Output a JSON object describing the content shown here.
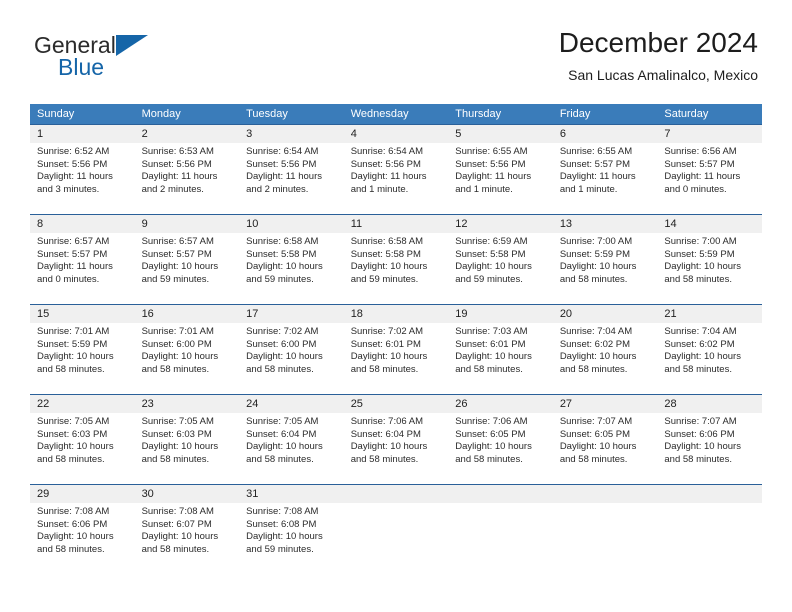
{
  "brand": {
    "name_part1": "General",
    "name_part2": "Blue",
    "flag_icon": "triangle-flag-icon"
  },
  "header": {
    "title": "December 2024",
    "subtitle": "San Lucas Amalinalco, Mexico"
  },
  "colors": {
    "header_blue": "#3a7cba",
    "row_divider_blue": "#2a6099",
    "daynum_background": "#f0f0f0",
    "brand_blue": "#1565a8",
    "text": "#2b2b2b"
  },
  "weekdays": [
    "Sunday",
    "Monday",
    "Tuesday",
    "Wednesday",
    "Thursday",
    "Friday",
    "Saturday"
  ],
  "weeks": [
    {
      "days": [
        {
          "num": "1",
          "sunrise": "Sunrise: 6:52 AM",
          "sunset": "Sunset: 5:56 PM",
          "daylight": "Daylight: 11 hours and 3 minutes."
        },
        {
          "num": "2",
          "sunrise": "Sunrise: 6:53 AM",
          "sunset": "Sunset: 5:56 PM",
          "daylight": "Daylight: 11 hours and 2 minutes."
        },
        {
          "num": "3",
          "sunrise": "Sunrise: 6:54 AM",
          "sunset": "Sunset: 5:56 PM",
          "daylight": "Daylight: 11 hours and 2 minutes."
        },
        {
          "num": "4",
          "sunrise": "Sunrise: 6:54 AM",
          "sunset": "Sunset: 5:56 PM",
          "daylight": "Daylight: 11 hours and 1 minute."
        },
        {
          "num": "5",
          "sunrise": "Sunrise: 6:55 AM",
          "sunset": "Sunset: 5:56 PM",
          "daylight": "Daylight: 11 hours and 1 minute."
        },
        {
          "num": "6",
          "sunrise": "Sunrise: 6:55 AM",
          "sunset": "Sunset: 5:57 PM",
          "daylight": "Daylight: 11 hours and 1 minute."
        },
        {
          "num": "7",
          "sunrise": "Sunrise: 6:56 AM",
          "sunset": "Sunset: 5:57 PM",
          "daylight": "Daylight: 11 hours and 0 minutes."
        }
      ]
    },
    {
      "days": [
        {
          "num": "8",
          "sunrise": "Sunrise: 6:57 AM",
          "sunset": "Sunset: 5:57 PM",
          "daylight": "Daylight: 11 hours and 0 minutes."
        },
        {
          "num": "9",
          "sunrise": "Sunrise: 6:57 AM",
          "sunset": "Sunset: 5:57 PM",
          "daylight": "Daylight: 10 hours and 59 minutes."
        },
        {
          "num": "10",
          "sunrise": "Sunrise: 6:58 AM",
          "sunset": "Sunset: 5:58 PM",
          "daylight": "Daylight: 10 hours and 59 minutes."
        },
        {
          "num": "11",
          "sunrise": "Sunrise: 6:58 AM",
          "sunset": "Sunset: 5:58 PM",
          "daylight": "Daylight: 10 hours and 59 minutes."
        },
        {
          "num": "12",
          "sunrise": "Sunrise: 6:59 AM",
          "sunset": "Sunset: 5:58 PM",
          "daylight": "Daylight: 10 hours and 59 minutes."
        },
        {
          "num": "13",
          "sunrise": "Sunrise: 7:00 AM",
          "sunset": "Sunset: 5:59 PM",
          "daylight": "Daylight: 10 hours and 58 minutes."
        },
        {
          "num": "14",
          "sunrise": "Sunrise: 7:00 AM",
          "sunset": "Sunset: 5:59 PM",
          "daylight": "Daylight: 10 hours and 58 minutes."
        }
      ]
    },
    {
      "days": [
        {
          "num": "15",
          "sunrise": "Sunrise: 7:01 AM",
          "sunset": "Sunset: 5:59 PM",
          "daylight": "Daylight: 10 hours and 58 minutes."
        },
        {
          "num": "16",
          "sunrise": "Sunrise: 7:01 AM",
          "sunset": "Sunset: 6:00 PM",
          "daylight": "Daylight: 10 hours and 58 minutes."
        },
        {
          "num": "17",
          "sunrise": "Sunrise: 7:02 AM",
          "sunset": "Sunset: 6:00 PM",
          "daylight": "Daylight: 10 hours and 58 minutes."
        },
        {
          "num": "18",
          "sunrise": "Sunrise: 7:02 AM",
          "sunset": "Sunset: 6:01 PM",
          "daylight": "Daylight: 10 hours and 58 minutes."
        },
        {
          "num": "19",
          "sunrise": "Sunrise: 7:03 AM",
          "sunset": "Sunset: 6:01 PM",
          "daylight": "Daylight: 10 hours and 58 minutes."
        },
        {
          "num": "20",
          "sunrise": "Sunrise: 7:04 AM",
          "sunset": "Sunset: 6:02 PM",
          "daylight": "Daylight: 10 hours and 58 minutes."
        },
        {
          "num": "21",
          "sunrise": "Sunrise: 7:04 AM",
          "sunset": "Sunset: 6:02 PM",
          "daylight": "Daylight: 10 hours and 58 minutes."
        }
      ]
    },
    {
      "days": [
        {
          "num": "22",
          "sunrise": "Sunrise: 7:05 AM",
          "sunset": "Sunset: 6:03 PM",
          "daylight": "Daylight: 10 hours and 58 minutes."
        },
        {
          "num": "23",
          "sunrise": "Sunrise: 7:05 AM",
          "sunset": "Sunset: 6:03 PM",
          "daylight": "Daylight: 10 hours and 58 minutes."
        },
        {
          "num": "24",
          "sunrise": "Sunrise: 7:05 AM",
          "sunset": "Sunset: 6:04 PM",
          "daylight": "Daylight: 10 hours and 58 minutes."
        },
        {
          "num": "25",
          "sunrise": "Sunrise: 7:06 AM",
          "sunset": "Sunset: 6:04 PM",
          "daylight": "Daylight: 10 hours and 58 minutes."
        },
        {
          "num": "26",
          "sunrise": "Sunrise: 7:06 AM",
          "sunset": "Sunset: 6:05 PM",
          "daylight": "Daylight: 10 hours and 58 minutes."
        },
        {
          "num": "27",
          "sunrise": "Sunrise: 7:07 AM",
          "sunset": "Sunset: 6:05 PM",
          "daylight": "Daylight: 10 hours and 58 minutes."
        },
        {
          "num": "28",
          "sunrise": "Sunrise: 7:07 AM",
          "sunset": "Sunset: 6:06 PM",
          "daylight": "Daylight: 10 hours and 58 minutes."
        }
      ]
    },
    {
      "days": [
        {
          "num": "29",
          "sunrise": "Sunrise: 7:08 AM",
          "sunset": "Sunset: 6:06 PM",
          "daylight": "Daylight: 10 hours and 58 minutes."
        },
        {
          "num": "30",
          "sunrise": "Sunrise: 7:08 AM",
          "sunset": "Sunset: 6:07 PM",
          "daylight": "Daylight: 10 hours and 58 minutes."
        },
        {
          "num": "31",
          "sunrise": "Sunrise: 7:08 AM",
          "sunset": "Sunset: 6:08 PM",
          "daylight": "Daylight: 10 hours and 59 minutes."
        },
        {
          "num": "",
          "sunrise": "",
          "sunset": "",
          "daylight": ""
        },
        {
          "num": "",
          "sunrise": "",
          "sunset": "",
          "daylight": ""
        },
        {
          "num": "",
          "sunrise": "",
          "sunset": "",
          "daylight": ""
        },
        {
          "num": "",
          "sunrise": "",
          "sunset": "",
          "daylight": ""
        }
      ]
    }
  ]
}
